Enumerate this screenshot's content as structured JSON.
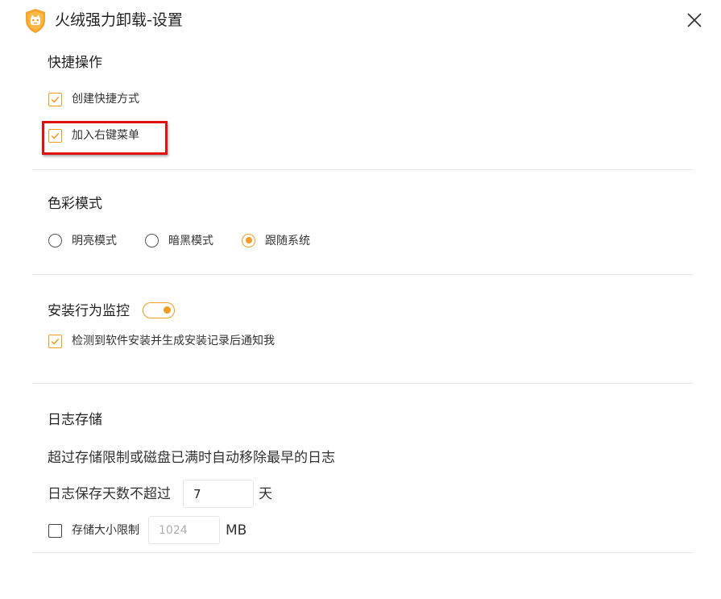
{
  "window": {
    "title": "火绒强力卸载-设置"
  },
  "colors": {
    "accent": "#f59b1f",
    "highlight": "#e01010"
  },
  "icons": {
    "logo": "shield-logo-icon",
    "close": "close-icon",
    "check": "check-icon"
  },
  "shortcuts": {
    "title": "快捷操作",
    "create_shortcut": {
      "label": "创建快捷方式",
      "checked": true
    },
    "context_menu": {
      "label": "加入右键菜单",
      "checked": true
    }
  },
  "color_mode": {
    "title": "色彩模式",
    "options": [
      {
        "label": "明亮模式",
        "selected": false
      },
      {
        "label": "暗黑模式",
        "selected": false
      },
      {
        "label": "跟随系统",
        "selected": true
      }
    ]
  },
  "install_monitor": {
    "title": "安装行为监控",
    "enabled": true,
    "notify": {
      "label": "检测到软件安装并生成安装记录后通知我",
      "checked": true
    }
  },
  "log_storage": {
    "title": "日志存储",
    "description": "超过存储限制或磁盘已满时自动移除最早的日志",
    "days_label": "日志保存天数不超过",
    "days_value": "7",
    "days_unit": "天",
    "size_limit": {
      "label": "存储大小限制",
      "checked": false,
      "placeholder": "1024",
      "unit": "MB"
    }
  }
}
